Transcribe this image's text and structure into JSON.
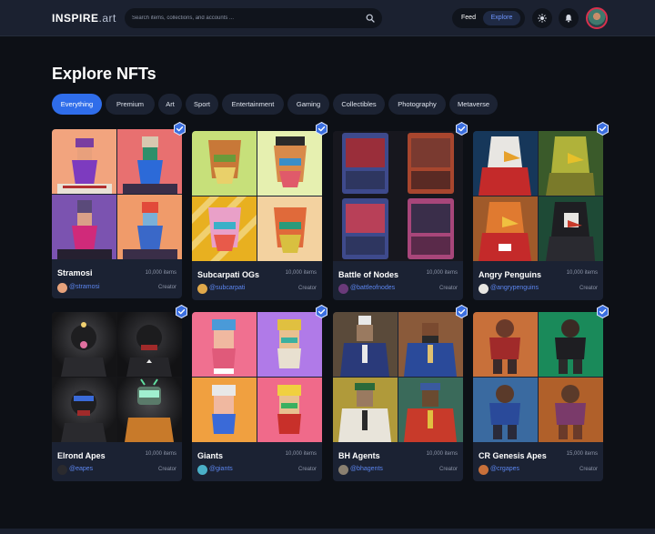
{
  "app": {
    "logo_main": "INSPIRE",
    "logo_suffix": ".art"
  },
  "search": {
    "placeholder": "Search items, collections, and accounts ..."
  },
  "nav": {
    "feed": "Feed",
    "explore": "Explore"
  },
  "page": {
    "title": "Explore NFTs"
  },
  "filters": [
    "Everything",
    "Premium",
    "Art",
    "Sport",
    "Entertainment",
    "Gaming",
    "Collectibles",
    "Photography",
    "Metaverse"
  ],
  "filters_active": "Everything",
  "colors": {
    "accent": "#2f6dea",
    "link": "#5c86f0",
    "card_bg": "#1b2233",
    "page_bg": "#0d1016",
    "verified_badge": "#3b6fe0"
  },
  "collections": [
    {
      "name": "Stramosi",
      "count": "10,000 items",
      "handle": "@stramosi",
      "role": "Creator",
      "verified": true
    },
    {
      "name": "Subcarpati OGs",
      "count": "10,000 items",
      "handle": "@subcarpati",
      "role": "Creator",
      "verified": true
    },
    {
      "name": "Battle of Nodes",
      "count": "10,000 items",
      "handle": "@battleofnodes",
      "role": "Creator",
      "verified": true
    },
    {
      "name": "Angry Penguins",
      "count": "10,000 items",
      "handle": "@angrypenguins",
      "role": "Creator",
      "verified": true
    },
    {
      "name": "Elrond Apes",
      "count": "10,000 items",
      "handle": "@eapes",
      "role": "Creator",
      "verified": true
    },
    {
      "name": "Giants",
      "count": "10,000 items",
      "handle": "@giants",
      "role": "Creator",
      "verified": true
    },
    {
      "name": "BH Agents",
      "count": "10,000 items",
      "handle": "@bhagents",
      "role": "Creator",
      "verified": true
    },
    {
      "name": "CR Genesis Apes",
      "count": "15,000 items",
      "handle": "@crgapes",
      "role": "Creator",
      "verified": true
    }
  ],
  "icons": {
    "search": "search-icon",
    "theme": "sun-icon",
    "notifications": "bell-icon",
    "verified": "verified-badge-icon"
  }
}
